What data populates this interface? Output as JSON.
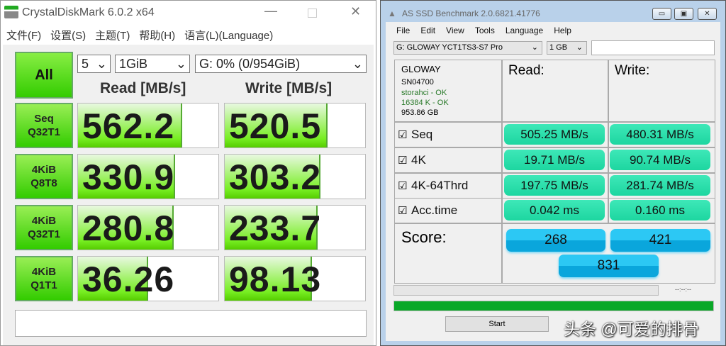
{
  "cdm": {
    "title": "CrystalDiskMark 6.0.2 x64",
    "menu": [
      "文件(F)",
      "设置(S)",
      "主题(T)",
      "帮助(H)",
      "语言(L)(Language)"
    ],
    "all_label": "All",
    "count": "5",
    "size": "1GiB",
    "drive": "G: 0% (0/954GiB)",
    "read_header": "Read [MB/s]",
    "write_header": "Write [MB/s]",
    "rows": [
      {
        "l1": "Seq",
        "l2": "Q32T1",
        "read": "562.2",
        "write": "520.5",
        "read_fill": 0.74,
        "write_fill": 0.73
      },
      {
        "l1": "4KiB",
        "l2": "Q8T8",
        "read": "330.9",
        "write": "303.2",
        "read_fill": 0.69,
        "write_fill": 0.68
      },
      {
        "l1": "4KiB",
        "l2": "Q32T1",
        "read": "280.8",
        "write": "233.7",
        "read_fill": 0.68,
        "write_fill": 0.66
      },
      {
        "l1": "4KiB",
        "l2": "Q1T1",
        "read": "36.26",
        "write": "98.13",
        "read_fill": 0.5,
        "write_fill": 0.62
      }
    ]
  },
  "asd": {
    "title": "AS SSD Benchmark 2.0.6821.41776",
    "menu": [
      "File",
      "Edit",
      "View",
      "Tools",
      "Language",
      "Help"
    ],
    "drive": "G: GLOWAY YCT1TS3-S7 Pro",
    "size": "1 GB",
    "info": {
      "name": "GLOWAY",
      "fw": "SN04700",
      "driver": "storahci - OK",
      "align": "16384 K - OK",
      "capacity": "953.86 GB"
    },
    "read_header": "Read:",
    "write_header": "Write:",
    "rows": [
      {
        "label": "Seq",
        "read": "505.25 MB/s",
        "write": "480.31 MB/s"
      },
      {
        "label": "4K",
        "read": "19.71 MB/s",
        "write": "90.74 MB/s"
      },
      {
        "label": "4K-64Thrd",
        "read": "197.75 MB/s",
        "write": "281.74 MB/s"
      },
      {
        "label": "Acc.time",
        "read": "0.042 ms",
        "write": "0.160 ms"
      }
    ],
    "score_label": "Score:",
    "score_read": "268",
    "score_write": "421",
    "score_total": "831",
    "time": "--:--:--",
    "start": "Start",
    "progress": 1.0,
    "watermark": "头条 @可爱的排骨"
  }
}
